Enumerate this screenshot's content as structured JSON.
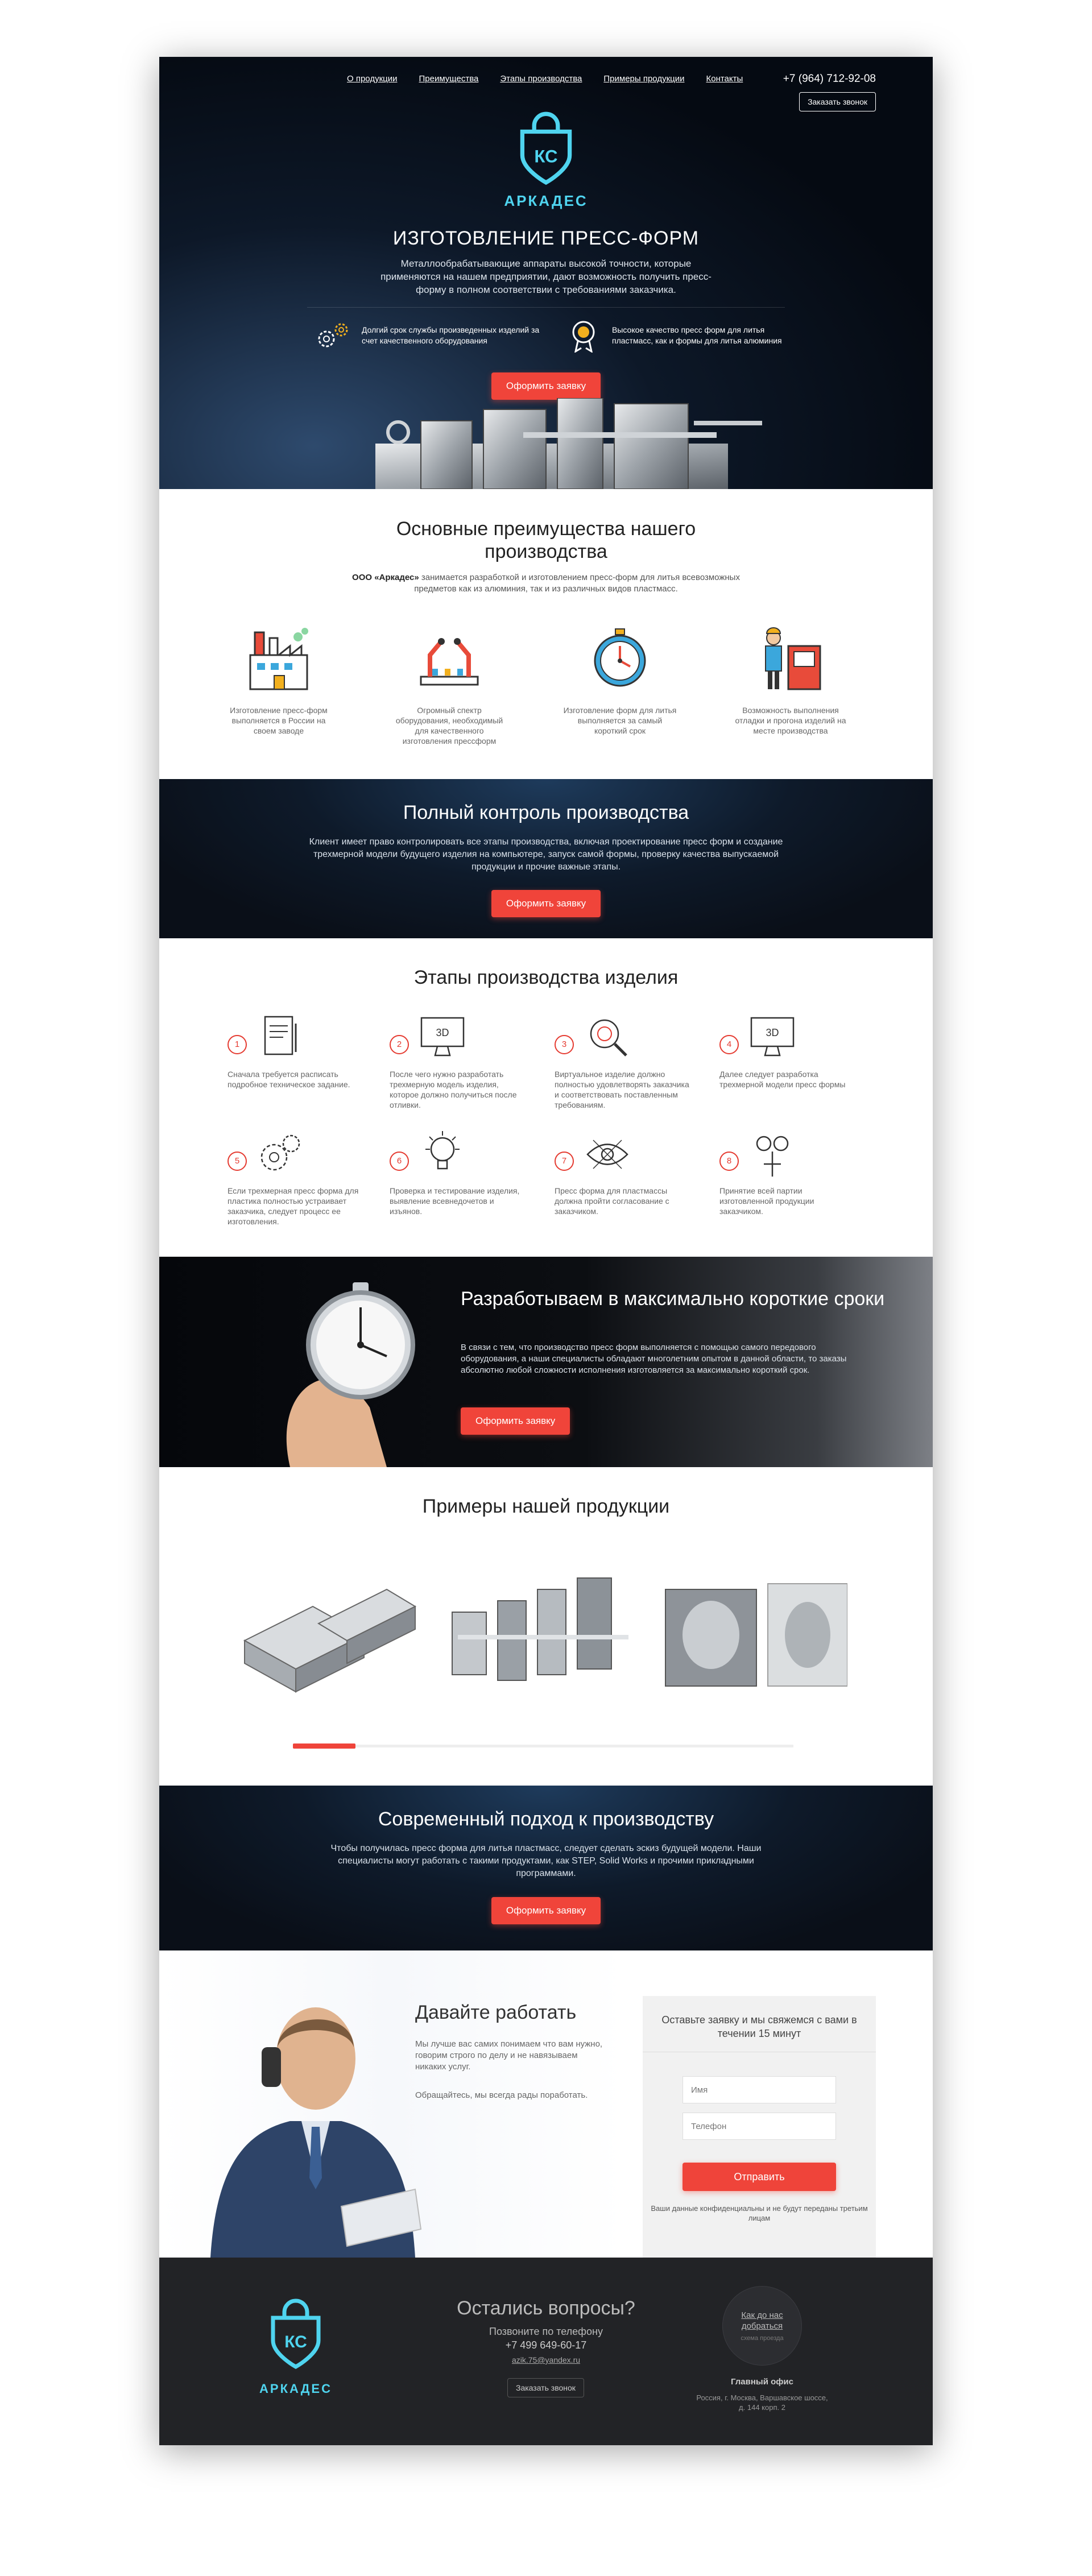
{
  "header": {
    "nav": [
      "О продукции",
      "Преимущества",
      "Этапы производства",
      "Примеры продукции",
      "Контакты"
    ],
    "phone": "+7 (964) 712-92-08",
    "call_button": "Заказать звонок"
  },
  "logo": {
    "text": "АРКАДЕС",
    "letters": "КС"
  },
  "hero": {
    "title": "ИЗГОТОВЛЕНИЕ ПРЕСС-ФОРМ",
    "lead": "Металлообрабатывающие аппараты высокой точности, которые применяются на нашем предприятии, дают возможность получить пресс-форму в полном соответствии с требованиями заказчика.",
    "feature1": "Долгий срок службы произведенных изделий за счет качественного оборудования",
    "feature2": "Высокое качество пресс форм для литья пластмасс, как и формы для литья алюминия",
    "cta": "Оформить заявку"
  },
  "advantages": {
    "title": "Основные преимущества нашего производства",
    "intro_company": "ООО «Аркадес»",
    "intro_rest": " занимается разработкой и изготовлением пресс-форм для литья всевозможных предметов как из алюминия, так и из различных видов пластмасс.",
    "items": [
      "Изготовление пресс-форм выполняется в России на своем заводе",
      "Огромный спектр оборудования, необходимый для качественного изготовления прессформ",
      "Изготовление форм для литья выполняется за самый короткий срок",
      "Возможность выполнения отладки и прогона изделий на месте производства"
    ]
  },
  "control": {
    "title": "Полный контроль производства",
    "text": "Клиент имеет право контролировать все этапы производства, включая проектирование пресс форм и создание трехмерной модели будущего изделия на компьютере, запуск самой формы, проверку качества выпускаемой продукции и прочие важные этапы.",
    "cta": "Оформить заявку"
  },
  "steps": {
    "title": "Этапы производства изделия",
    "items": [
      {
        "num": "1",
        "text": "Сначала требуется расписать подробное техническое задание."
      },
      {
        "num": "2",
        "text": "После чего нужно разработать трехмерную модель изделия, которое должно получиться после отливки."
      },
      {
        "num": "3",
        "text": "Виртуальное изделие должно полностью удовлетворять заказчика и соответствовать поставленным требованиям."
      },
      {
        "num": "4",
        "text": "Далее следует разработка трехмерной модели пресс формы"
      },
      {
        "num": "5",
        "text": "Если трехмерная пресс форма для пластика полностью устраивает заказчика, следует процесс ее изготовления."
      },
      {
        "num": "6",
        "text": "Проверка и тестирование изделия, выявление всевнедочетов и изъянов."
      },
      {
        "num": "7",
        "text": "Пресс форма для пластмассы должна пройти согласование с заказчиком."
      },
      {
        "num": "8",
        "text": "Принятие всей партии изготовленной продукции заказчиком."
      }
    ]
  },
  "deadline": {
    "title": "Разработываем в максимально короткие сроки",
    "text": "В связи с тем, что производство пресс форм выполняется с помощью самого передового оборудования, а наши специалисты обладают многолетним опытом в данной области, то заказы абсолютно любой сложности исполнения изготовляется за максимально короткий срок.",
    "cta": "Оформить заявку"
  },
  "products": {
    "title": "Примеры нашей продукции",
    "slider_position": 0.125
  },
  "modern": {
    "title": "Современный подход к производству",
    "text": "Чтобы получилась пресс форма для литья пластмасс, следует сделать эскиз будущей модели. Наши специалисты могут работать с такими продуктами, как STEP, Solid Works и прочими прикладными программами.",
    "cta": "Оформить заявку"
  },
  "contact": {
    "title": "Давайте работать",
    "text1": "Мы лучше вас самих понимаем что вам нужно, говорим строго по делу и не навязываем никаких услуг.",
    "text2": "Обращайтесь, мы всегда рады поработать.",
    "form_title": "Оставьте заявку и мы свяжемся с вами в течении 15 минут",
    "name_placeholder": "Имя",
    "phone_placeholder": "Телефон",
    "submit": "Отправить",
    "privacy": "Ваши данные конфиденциальны и не будут переданы третьим лицам"
  },
  "footer": {
    "title": "Остались вопросы?",
    "call_text": "Позвоните по телефону",
    "phone": "+7 499 649-60-17",
    "email": "azik.75@yandex.ru",
    "call_button": "Заказать звонок",
    "route_link": "Как до нас добраться",
    "route_sub": "схема проезда",
    "office": "Главный офис",
    "address": "Россия, г. Москва, Варшавское шоссе, д. 144 корп. 2"
  },
  "colors": {
    "accent": "#ef443a",
    "brand": "#4fd4ef",
    "dark": "#0e1a2a"
  }
}
